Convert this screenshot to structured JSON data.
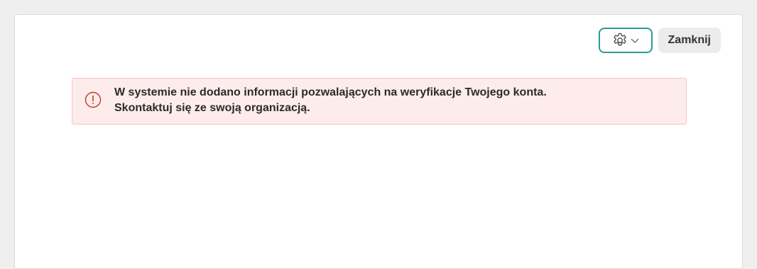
{
  "toolbar": {
    "settings_icon": "gear-icon",
    "dropdown_icon": "chevron-down-icon",
    "close_label": "Zamknij"
  },
  "alert": {
    "icon": "exclamation-circle-icon",
    "line1": "W systemie nie dodano informacji pozwalających na weryfikacje Twojego konta.",
    "line2": "Skontaktuj się ze swoją organizacją."
  },
  "colors": {
    "accent": "#2a9d8f",
    "alert_background": "#fdeceb",
    "alert_border": "#f4c6c3",
    "alert_icon": "#c0392b"
  }
}
